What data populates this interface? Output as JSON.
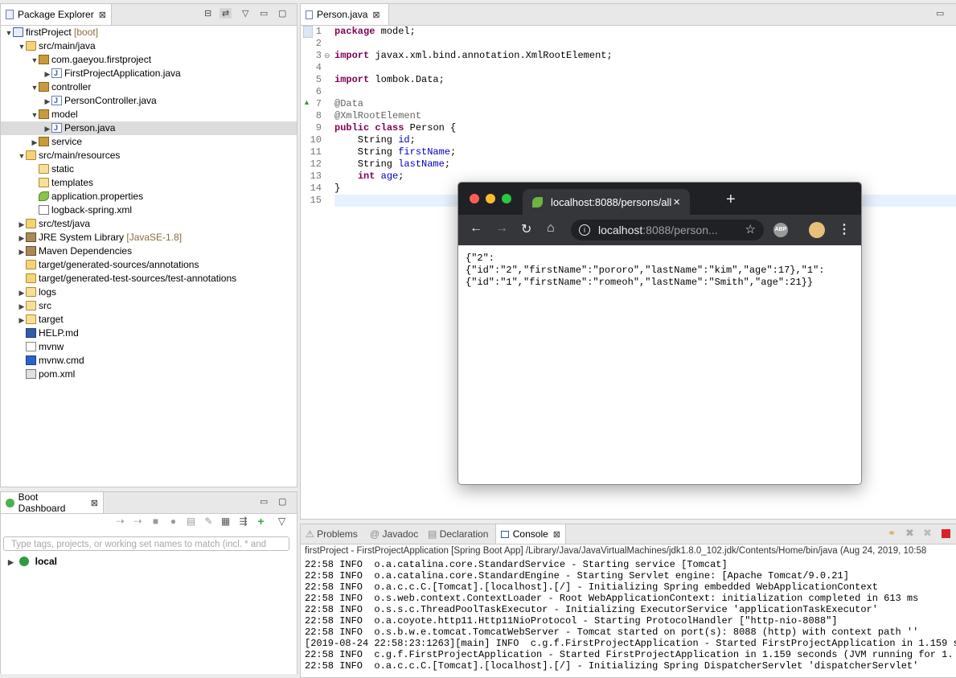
{
  "package_explorer": {
    "tab_label": "Package Explorer",
    "tree": [
      {
        "indent": 0,
        "arrow": "▼",
        "icon": "proj",
        "label": "firstProject",
        "suffix": " [boot]"
      },
      {
        "indent": 1,
        "arrow": "▼",
        "icon": "srcf",
        "label": "src/main/java",
        "suffix": ""
      },
      {
        "indent": 2,
        "arrow": "▼",
        "icon": "pkg",
        "label": "com.gaeyou.firstproject",
        "suffix": ""
      },
      {
        "indent": 3,
        "arrow": "▶",
        "icon": "jfile",
        "label": "FirstProjectApplication.java",
        "suffix": ""
      },
      {
        "indent": 2,
        "arrow": "▼",
        "icon": "pkg",
        "label": "controller",
        "suffix": ""
      },
      {
        "indent": 3,
        "arrow": "▶",
        "icon": "jfile",
        "label": "PersonController.java",
        "suffix": ""
      },
      {
        "indent": 2,
        "arrow": "▼",
        "icon": "pkg",
        "label": "model",
        "suffix": ""
      },
      {
        "indent": 3,
        "arrow": "▶",
        "icon": "jfile",
        "label": "Person.java",
        "suffix": "",
        "selected": true
      },
      {
        "indent": 2,
        "arrow": "▶",
        "icon": "pkg",
        "label": "service",
        "suffix": ""
      },
      {
        "indent": 1,
        "arrow": "▼",
        "icon": "srcf",
        "label": "src/main/resources",
        "suffix": ""
      },
      {
        "indent": 2,
        "arrow": "",
        "icon": "folder",
        "label": "static",
        "suffix": ""
      },
      {
        "indent": 2,
        "arrow": "",
        "icon": "folder",
        "label": "templates",
        "suffix": ""
      },
      {
        "indent": 2,
        "arrow": "",
        "icon": "leaf",
        "label": "application.properties",
        "suffix": ""
      },
      {
        "indent": 2,
        "arrow": "",
        "icon": "xml",
        "label": "logback-spring.xml",
        "suffix": ""
      },
      {
        "indent": 1,
        "arrow": "▶",
        "icon": "srcf",
        "label": "src/test/java",
        "suffix": ""
      },
      {
        "indent": 1,
        "arrow": "▶",
        "icon": "lib",
        "label": "JRE System Library",
        "suffix": " [JavaSE-1.8]"
      },
      {
        "indent": 1,
        "arrow": "▶",
        "icon": "lib",
        "label": "Maven Dependencies",
        "suffix": ""
      },
      {
        "indent": 1,
        "arrow": "",
        "icon": "srcf",
        "label": "target/generated-sources/annotations",
        "suffix": ""
      },
      {
        "indent": 1,
        "arrow": "",
        "icon": "srcf",
        "label": "target/generated-test-sources/test-annotations",
        "suffix": ""
      },
      {
        "indent": 1,
        "arrow": "▶",
        "icon": "folder",
        "label": "logs",
        "suffix": ""
      },
      {
        "indent": 1,
        "arrow": "▶",
        "icon": "folder",
        "label": "src",
        "suffix": ""
      },
      {
        "indent": 1,
        "arrow": "▶",
        "icon": "folder",
        "label": "target",
        "suffix": ""
      },
      {
        "indent": 1,
        "arrow": "",
        "icon": "md",
        "label": "HELP.md",
        "suffix": ""
      },
      {
        "indent": 1,
        "arrow": "",
        "icon": "txt",
        "label": "mvnw",
        "suffix": ""
      },
      {
        "indent": 1,
        "arrow": "",
        "icon": "cmd",
        "label": "mvnw.cmd",
        "suffix": ""
      },
      {
        "indent": 1,
        "arrow": "",
        "icon": "mvn",
        "label": "pom.xml",
        "suffix": ""
      }
    ]
  },
  "boot_dashboard": {
    "tab_label": "Boot Dashboard",
    "filter_placeholder": "Type tags, projects, or working set names to match (incl. * and",
    "local_label": "local"
  },
  "editor": {
    "tab_label": "Person.java",
    "lines": [
      "package model;",
      "",
      "import javax.xml.bind.annotation.XmlRootElement;",
      "",
      "import lombok.Data;",
      "",
      "@Data",
      "@XmlRootElement",
      "public class Person {",
      "    String id;",
      "    String firstName;",
      "    String lastName;",
      "    int age;",
      "}",
      ""
    ]
  },
  "console_area": {
    "tabs": [
      "Problems",
      "Javadoc",
      "Declaration",
      "Console"
    ],
    "header": "firstProject - FirstProjectApplication [Spring Boot App] /Library/Java/JavaVirtualMachines/jdk1.8.0_102.jdk/Contents/Home/bin/java (Aug 24, 2019, 10:58",
    "lines": [
      "22:58 INFO  o.a.catalina.core.StandardService - Starting service [Tomcat]",
      "22:58 INFO  o.a.catalina.core.StandardEngine - Starting Servlet engine: [Apache Tomcat/9.0.21]",
      "22:58 INFO  o.a.c.c.C.[Tomcat].[localhost].[/] - Initializing Spring embedded WebApplicationContext",
      "22:58 INFO  o.s.web.context.ContextLoader - Root WebApplicationContext: initialization completed in 613 ms",
      "22:58 INFO  o.s.s.c.ThreadPoolTaskExecutor - Initializing ExecutorService 'applicationTaskExecutor'",
      "22:58 INFO  o.a.coyote.http11.Http11NioProtocol - Starting ProtocolHandler [\"http-nio-8088\"]",
      "22:58 INFO  o.s.b.w.e.tomcat.TomcatWebServer - Tomcat started on port(s): 8088 (http) with context path ''",
      "[2019-08-24 22:58:23:1263][main] INFO  c.g.f.FirstProjectApplication - Started FirstProjectApplication in 1.159 s",
      "22:58 INFO  c.g.f.FirstProjectApplication - Started FirstProjectApplication in 1.159 seconds (JVM running for 1.",
      "22:58 INFO  o.a.c.c.C.[Tomcat].[localhost].[/] - Initializing Spring DispatcherServlet 'dispatcherServlet'"
    ]
  },
  "browser": {
    "tab_title": "localhost:8088/persons/all",
    "url_host": "localhost",
    "url_rest": ":8088/person...",
    "abp_label": "ABP",
    "body_lines": [
      "{\"2\":",
      "{\"id\":\"2\",\"firstName\":\"pororo\",\"lastName\":\"kim\",\"age\":17},\"1\":",
      "{\"id\":\"1\",\"firstName\":\"romeoh\",\"lastName\":\"Smith\",\"age\":21}}"
    ]
  }
}
